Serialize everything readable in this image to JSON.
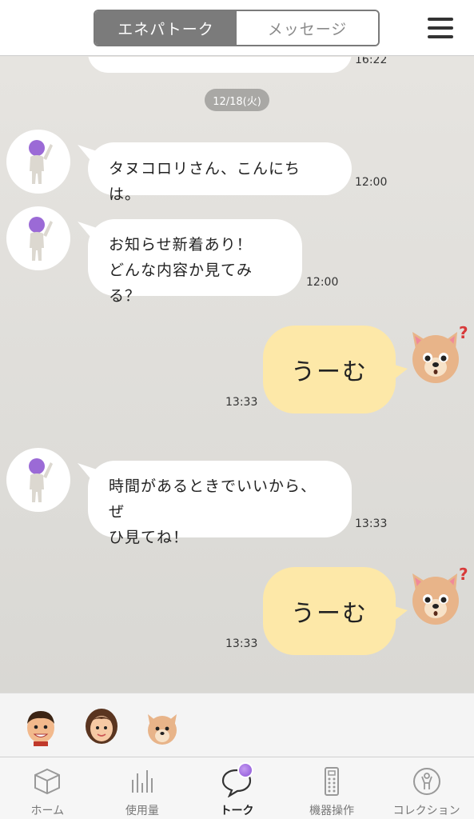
{
  "header": {
    "tabs": [
      {
        "label": "エネパトーク",
        "active": true
      },
      {
        "label": "メッセージ",
        "active": false
      }
    ],
    "menu_icon": "hamburger-icon"
  },
  "chat": {
    "prev_time": "16:22",
    "date": "12/18(火)",
    "messages": [
      {
        "sender": "bot",
        "lines": [
          "タヌコロリさん、こんにちは。"
        ],
        "time": "12:00"
      },
      {
        "sender": "bot",
        "lines": [
          "お知らせ新着あり！",
          "どんな内容か見てみる？"
        ],
        "time": "12:00"
      },
      {
        "sender": "user",
        "lines": [
          "うーむ"
        ],
        "time": "13:33"
      },
      {
        "sender": "bot",
        "lines": [
          "時間があるときでいいから、ぜ",
          "ひ見てね！"
        ],
        "time": "13:33"
      },
      {
        "sender": "user",
        "lines": [
          "うーむ"
        ],
        "time": "13:33"
      }
    ]
  },
  "characters": [
    "boy-avatar-icon",
    "woman-avatar-icon",
    "dog-avatar-icon"
  ],
  "nav": {
    "items": [
      {
        "label": "ホーム",
        "icon": "cube-icon",
        "active": false
      },
      {
        "label": "使用量",
        "icon": "bar-chart-icon",
        "active": false
      },
      {
        "label": "トーク",
        "icon": "speech-bubble-icon",
        "active": true
      },
      {
        "label": "機器操作",
        "icon": "remote-control-icon",
        "active": false
      },
      {
        "label": "コレクション",
        "icon": "collection-figure-icon",
        "active": false
      }
    ]
  },
  "colors": {
    "accent": "#8a52d6",
    "user_bubble": "#fde8a8",
    "bot_bubble": "#ffffff",
    "segment_active": "#7b7b7b"
  }
}
